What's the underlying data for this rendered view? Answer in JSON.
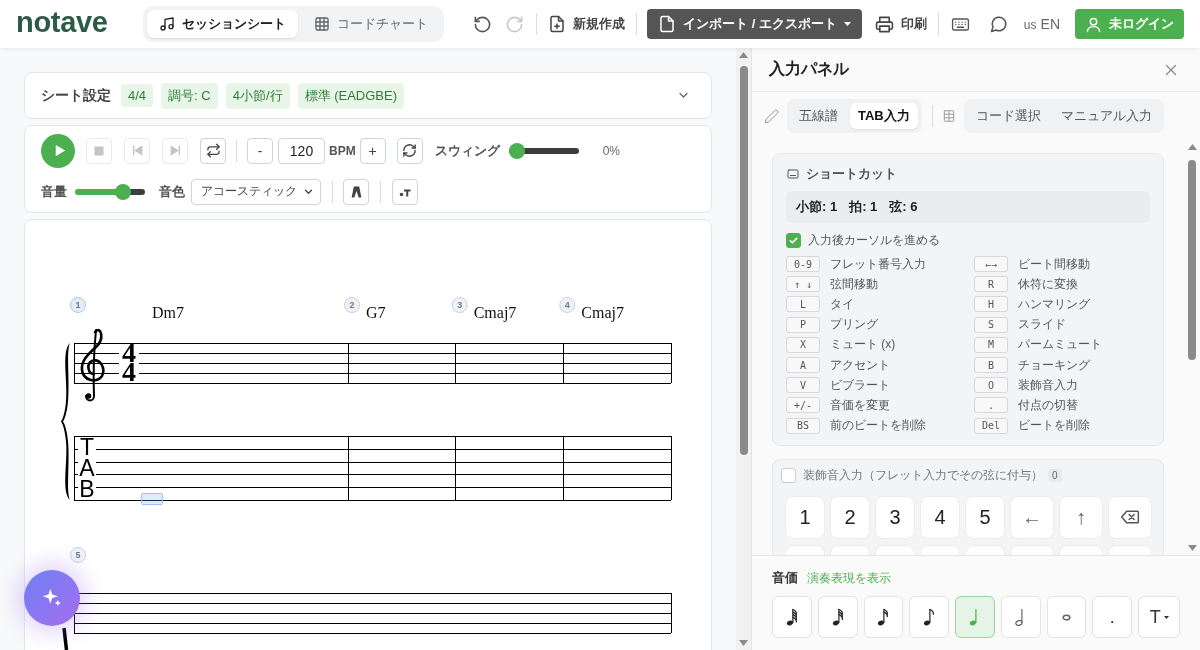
{
  "header": {
    "logo": "notave",
    "view_tabs": [
      {
        "label": "セッションシート",
        "selected": true
      },
      {
        "label": "コードチャート",
        "selected": false
      }
    ],
    "undo": {
      "disabled": false
    },
    "redo": {
      "disabled": true
    },
    "new_button": "新規作成",
    "import_export_button": "インポート / エクスポート",
    "print_button": "印刷",
    "language": {
      "flag": "us",
      "code": "EN"
    },
    "login_button": "未ログイン"
  },
  "sheet_settings": {
    "title": "シート設定",
    "chips": [
      "4/4",
      "調号: C",
      "4小節/行",
      "標準 (EADGBE)"
    ],
    "expanded": false
  },
  "transport": {
    "playing": false,
    "stop": {
      "disabled": true
    },
    "previous": {
      "disabled": true
    },
    "next": {
      "disabled": true
    },
    "loop": {
      "disabled": false
    },
    "tempo_minus": "-",
    "tempo": "120",
    "tempo_unit": "BPM",
    "tempo_plus": "+",
    "swing_label": "スウィング",
    "swing": {
      "level": 0
    },
    "swing_reading": "0%",
    "volume_label": "音量",
    "volume": {
      "level": 0.74
    },
    "tone_label": "音色",
    "tone": "アコースティック"
  },
  "score": {
    "systems": [
      {
        "clef": true,
        "time_signature": [
          "4",
          "4"
        ],
        "tab_label": [
          "T",
          "A",
          "B"
        ],
        "measures": [
          {
            "number": "1",
            "chord": "Dm7",
            "cursor": true
          },
          {
            "number": "2",
            "chord": "G7",
            "cursor": false
          },
          {
            "number": "3",
            "chord": "Cmaj7",
            "cursor": false
          },
          {
            "number": "4",
            "chord": "Cmaj7",
            "cursor": false
          }
        ]
      },
      {
        "measures": [
          {
            "number": "5",
            "cursor": false
          }
        ]
      }
    ]
  },
  "input_panel": {
    "title": "入力パネル",
    "mode_groups": [
      {
        "modes": [
          {
            "label": "五線譜",
            "selected": false
          },
          {
            "label": "TAB入力",
            "selected": true
          }
        ]
      },
      {
        "modes": [
          {
            "label": "コード選択",
            "selected": false
          },
          {
            "label": "マニュアル入力",
            "selected": false
          }
        ]
      }
    ],
    "shortcuts": {
      "title": "ショートカット",
      "position": [
        "小節: 1",
        "拍: 1",
        "弦: 6"
      ],
      "advance_cursor": {
        "label": "入力後カーソルを進める",
        "checked": true
      },
      "items": [
        {
          "key": "0-9",
          "label": "フレット番号入力"
        },
        {
          "key": "←→",
          "label": "ビート間移動"
        },
        {
          "key": "↑ ↓",
          "label": "弦間移動"
        },
        {
          "key": "R",
          "label": "休符に変換"
        },
        {
          "key": "L",
          "label": "タイ"
        },
        {
          "key": "H",
          "label": "ハンマリング"
        },
        {
          "key": "P",
          "label": "プリング"
        },
        {
          "key": "S",
          "label": "スライド"
        },
        {
          "key": "X",
          "label": "ミュート (x)"
        },
        {
          "key": "M",
          "label": "パームミュート"
        },
        {
          "key": "A",
          "label": "アクセント"
        },
        {
          "key": "B",
          "label": "チョーキング"
        },
        {
          "key": "V",
          "label": "ビブラート"
        },
        {
          "key": "O",
          "label": "装飾音入力"
        },
        {
          "key": "+/-",
          "label": "音価を変更"
        },
        {
          "key": ".",
          "label": "付点の切替"
        },
        {
          "key": "BS",
          "label": "前のビートを削除"
        },
        {
          "key": "Del",
          "label": "ビートを削除"
        }
      ]
    },
    "grace_notes": {
      "label": "装飾音入力（フレット入力でその弦に付与）",
      "checked": false,
      "count": "0",
      "keypad": [
        [
          {
            "kind": "key",
            "label": "1"
          },
          {
            "kind": "key",
            "label": "2"
          },
          {
            "kind": "key",
            "label": "3"
          },
          {
            "kind": "key",
            "label": "4"
          },
          {
            "kind": "key",
            "label": "5"
          },
          {
            "kind": "key",
            "label": "←"
          },
          {
            "kind": "key",
            "label": "↑"
          },
          {
            "kind": "backspace"
          }
        ],
        [
          {
            "kind": "cut"
          },
          {
            "kind": "cut"
          },
          {
            "kind": "cut"
          },
          {
            "kind": "cut"
          },
          {
            "kind": "cut"
          },
          {
            "kind": "cut"
          },
          {
            "kind": "cut"
          },
          {
            "kind": "cut"
          }
        ]
      ]
    },
    "note_values": {
      "title": "音価",
      "toggle_link": "演奏表現を表示",
      "items": [
        {
          "kind": "sixtyfourth",
          "selected": false
        },
        {
          "kind": "thirtysecond",
          "selected": false
        },
        {
          "kind": "sixteenth",
          "selected": false
        },
        {
          "kind": "eighth",
          "selected": false
        },
        {
          "kind": "quarter",
          "selected": true
        },
        {
          "kind": "half",
          "selected": false
        },
        {
          "kind": "whole",
          "selected": false
        },
        {
          "kind": "dot",
          "label": ".",
          "selected": false
        },
        {
          "kind": "menu",
          "label": "T",
          "selected": false
        }
      ]
    }
  }
}
